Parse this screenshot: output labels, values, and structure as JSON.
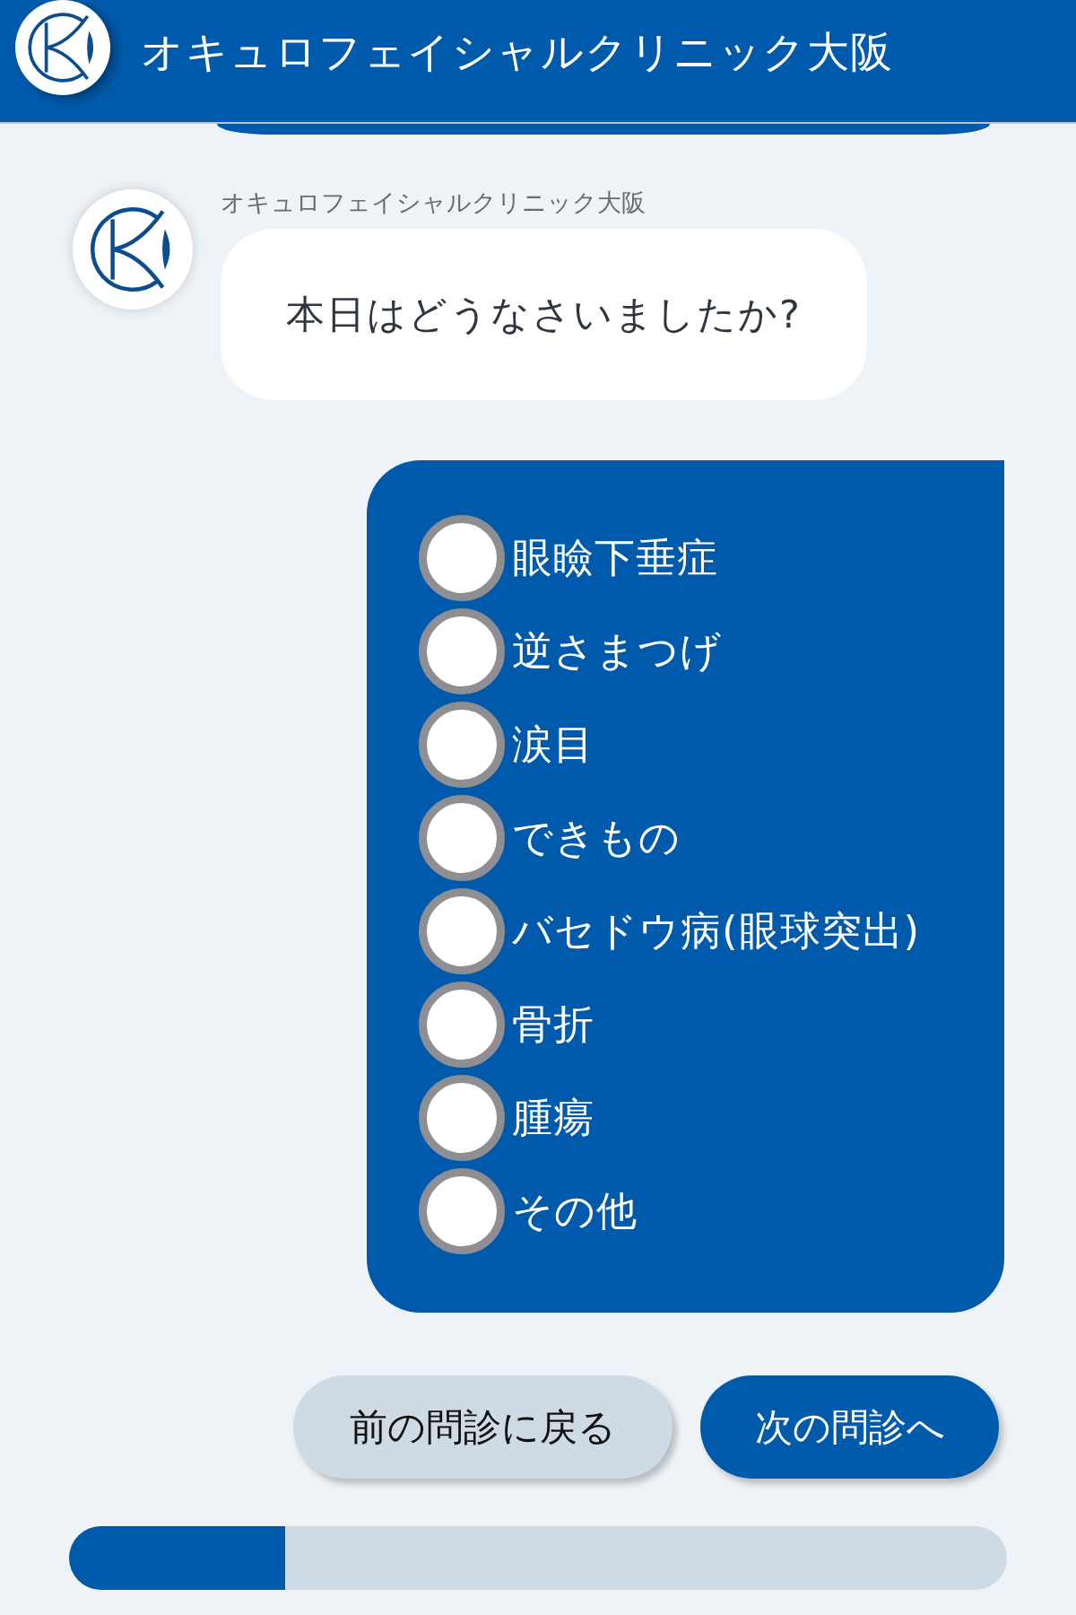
{
  "header": {
    "title": "オキュロフェイシャルクリニック大阪"
  },
  "messages": [
    {
      "kind": "bot",
      "sender": "オキュロフェイシャルクリニック大阪",
      "text": "本日はどうなさいましたか?"
    }
  ],
  "options": [
    {
      "label": "眼瞼下垂症",
      "selected": false
    },
    {
      "label": "逆さまつげ",
      "selected": false
    },
    {
      "label": "涙目",
      "selected": false
    },
    {
      "label": "できもの",
      "selected": false
    },
    {
      "label": "バセドウ病(眼球突出)",
      "selected": false
    },
    {
      "label": "骨折",
      "selected": false
    },
    {
      "label": "腫瘍",
      "selected": false
    },
    {
      "label": "その他",
      "selected": false
    }
  ],
  "buttons": [
    {
      "kind": "secondary",
      "label": "前の問診に戻る"
    },
    {
      "kind": "primary",
      "label": "次の問診へ"
    }
  ],
  "progress": {
    "level": 0.23
  }
}
